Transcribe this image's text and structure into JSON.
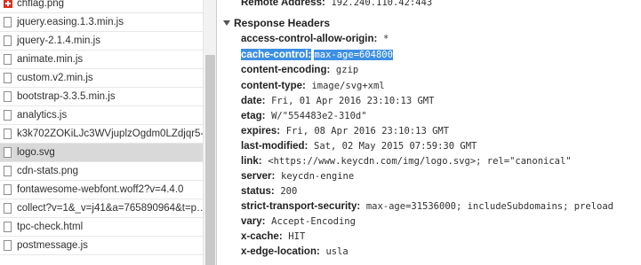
{
  "file_list": [
    {
      "name": "chflag.png",
      "icon": "favicon-icon",
      "selected": false
    },
    {
      "name": "jquery.easing.1.3.min.js",
      "icon": "file-icon",
      "selected": false
    },
    {
      "name": "jquery-2.1.4.min.js",
      "icon": "file-icon",
      "selected": false
    },
    {
      "name": "animate.min.js",
      "icon": "file-icon",
      "selected": false
    },
    {
      "name": "custom.v2.min.js",
      "icon": "file-icon",
      "selected": false
    },
    {
      "name": "bootstrap-3.3.5.min.js",
      "icon": "file-icon",
      "selected": false
    },
    {
      "name": "analytics.js",
      "icon": "file-icon",
      "selected": false
    },
    {
      "name": "k3k702ZOKiLJc3WVjuplzOgdm0LZdjqr5-…",
      "icon": "file-icon",
      "selected": false
    },
    {
      "name": "logo.svg",
      "icon": "file-icon",
      "selected": true
    },
    {
      "name": "cdn-stats.png",
      "icon": "file-icon",
      "selected": false
    },
    {
      "name": "fontawesome-webfont.woff2?v=4.4.0",
      "icon": "file-icon",
      "selected": false
    },
    {
      "name": "collect?v=1&_v=j41&a=765890964&t=p…",
      "icon": "file-icon",
      "selected": false
    },
    {
      "name": "tpc-check.html",
      "icon": "file-icon",
      "selected": false
    },
    {
      "name": "postmessage.js",
      "icon": "file-icon",
      "selected": false
    }
  ],
  "remote_address": {
    "key": "Remote Address:",
    "value": "192.240.110.42:443"
  },
  "response_headers": {
    "title": "Response Headers",
    "headers": [
      {
        "key": "access-control-allow-origin:",
        "value": "*"
      },
      {
        "key": "cache-control:",
        "value": "max-age=604800",
        "highlighted": true
      },
      {
        "key": "content-encoding:",
        "value": "gzip"
      },
      {
        "key": "content-type:",
        "value": "image/svg+xml"
      },
      {
        "key": "date:",
        "value": "Fri, 01 Apr 2016 23:10:13 GMT"
      },
      {
        "key": "etag:",
        "value": "W/\"554483e2-310d\""
      },
      {
        "key": "expires:",
        "value": "Fri, 08 Apr 2016 23:10:13 GMT"
      },
      {
        "key": "last-modified:",
        "value": "Sat, 02 May 2015 07:59:30 GMT"
      },
      {
        "key": "link:",
        "value": "<https://www.keycdn.com/img/logo.svg>; rel=\"canonical\""
      },
      {
        "key": "server:",
        "value": "keycdn-engine"
      },
      {
        "key": "status:",
        "value": "200"
      },
      {
        "key": "strict-transport-security:",
        "value": "max-age=31536000; includeSubdomains; preload"
      },
      {
        "key": "vary:",
        "value": "Accept-Encoding"
      },
      {
        "key": "x-cache:",
        "value": "HIT"
      },
      {
        "key": "x-edge-location:",
        "value": "usla"
      }
    ]
  },
  "colors": {
    "selection_highlight": "#3d8fe3",
    "selected_row": "#d9d9d9",
    "favicon": "#e0301e"
  }
}
